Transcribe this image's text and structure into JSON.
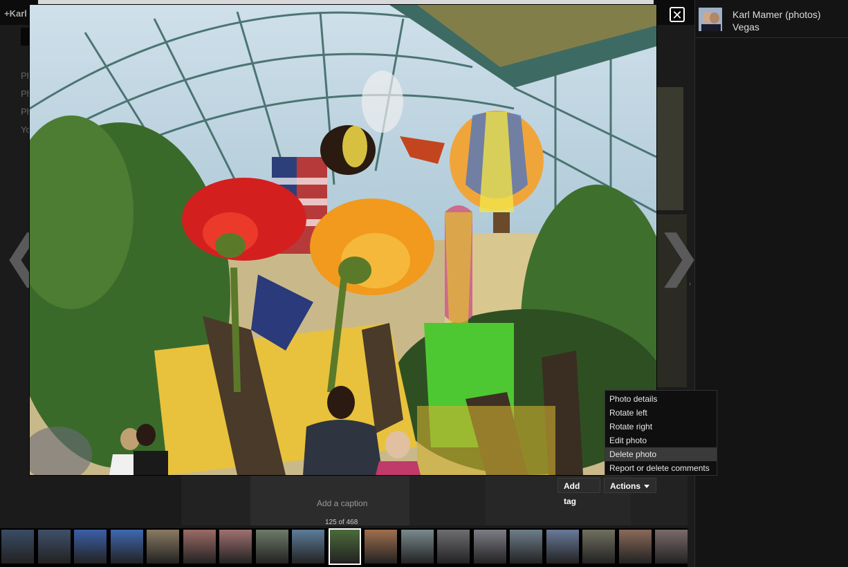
{
  "background": {
    "top_fragment": "+Karl",
    "lines": [
      "Ph",
      "Ph",
      "Ph",
      "Yo"
    ]
  },
  "viewer": {
    "close_icon": "close-icon",
    "prev_icon": "chevron-left-icon",
    "next_icon": "chevron-right-icon",
    "close_glyph": "✕",
    "prev_glyph": "❮",
    "next_glyph": "❯"
  },
  "sidebar": {
    "owner": "Karl Mamer (photos)",
    "album": "Vegas",
    "collapse_glyph": "›"
  },
  "caption": {
    "placeholder": "Add a caption",
    "counter": "125 of 468"
  },
  "buttons": {
    "add_tag": "Add tag",
    "actions": "Actions"
  },
  "menu": {
    "items": [
      "Photo details",
      "Rotate left",
      "Rotate right",
      "Edit photo",
      "Delete photo",
      "Report or delete comments"
    ],
    "highlighted_index": 4
  },
  "filmstrip": {
    "count": 19,
    "current_index": 9,
    "colors": [
      "#3a4c66",
      "#40506a",
      "#3c5fa8",
      "#4068b2",
      "#8a7a62",
      "#9b6b66",
      "#a07070",
      "#6e7a6a",
      "#5d7d9a",
      "#4c6b3a",
      "#a06f4e",
      "#7a8a8e",
      "#6e6e72",
      "#7d7d86",
      "#6e7e8a",
      "#6a7a9a",
      "#707060",
      "#8a6a5a",
      "#7a6a6a"
    ]
  },
  "colors": {
    "menu_bg": "#0f0f0f",
    "menu_highlight": "#3a3a3a",
    "button_bg": "#2c2c2c"
  }
}
